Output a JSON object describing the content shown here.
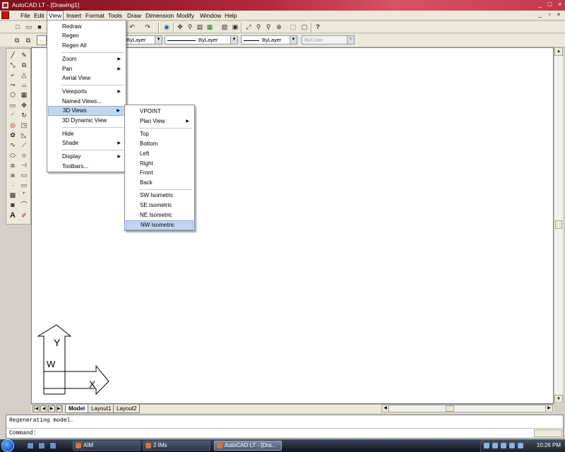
{
  "window": {
    "title": "AutoCAD LT - [Drawing1]",
    "minimize": "_",
    "maximize": "□",
    "close": "×"
  },
  "menubar": {
    "items": [
      "File",
      "Edit",
      "View",
      "Insert",
      "Format",
      "Tools",
      "Draw",
      "Dimension",
      "Modify",
      "Window",
      "Help"
    ],
    "active": "View",
    "child_controls": [
      "_",
      "▫",
      "×"
    ]
  },
  "properties_toolbar": {
    "color": "ByLayer",
    "linetype": "ByLayer",
    "lineweight": "ByLayer",
    "plotstyle": "ByColor"
  },
  "view_menu": {
    "items": [
      {
        "label": "Redraw"
      },
      {
        "label": "Regen"
      },
      {
        "label": "Regen All"
      },
      {
        "label": "Zoom",
        "submenu": true
      },
      {
        "label": "Pan",
        "submenu": true
      },
      {
        "label": "Aerial View"
      },
      {
        "label": "Viewports",
        "submenu": true
      },
      {
        "label": "Named Views..."
      },
      {
        "label": "3D Views",
        "submenu": true,
        "highlighted": true
      },
      {
        "label": "3D Dynamic View"
      },
      {
        "label": "Hide"
      },
      {
        "label": "Shade",
        "submenu": true
      },
      {
        "label": "Display",
        "submenu": true
      },
      {
        "label": "Toolbars..."
      }
    ]
  },
  "views3d_menu": {
    "items": [
      {
        "label": "VPOINT"
      },
      {
        "label": "Plan View",
        "submenu": true
      },
      {
        "label": "Top"
      },
      {
        "label": "Bottom"
      },
      {
        "label": "Left"
      },
      {
        "label": "Right"
      },
      {
        "label": "Front"
      },
      {
        "label": "Back"
      },
      {
        "label": "SW Isometric"
      },
      {
        "label": "SE Isometric"
      },
      {
        "label": "NE Isometric"
      },
      {
        "label": "NW Isometric",
        "highlighted": true
      }
    ]
  },
  "ucs_icon": {
    "y_label": "Y",
    "w_label": "W",
    "x_label": "X"
  },
  "layout_tabs": {
    "model": "Model",
    "layout1": "Layout1",
    "layout2": "Layout2"
  },
  "command": {
    "history": "Regenerating model.",
    "prompt": "Command:"
  },
  "taskbar": {
    "tasks": [
      {
        "label": "AIM",
        "active": false
      },
      {
        "label": "2 IMs",
        "active": false
      },
      {
        "label": "AutoCAD LT - [Dra...",
        "active": true
      }
    ],
    "clock": "10:26 PM"
  },
  "colors": {
    "title_bar": "#b0283a",
    "menu_highlight": "#c2d6ef",
    "canvas": "#ffffff"
  }
}
